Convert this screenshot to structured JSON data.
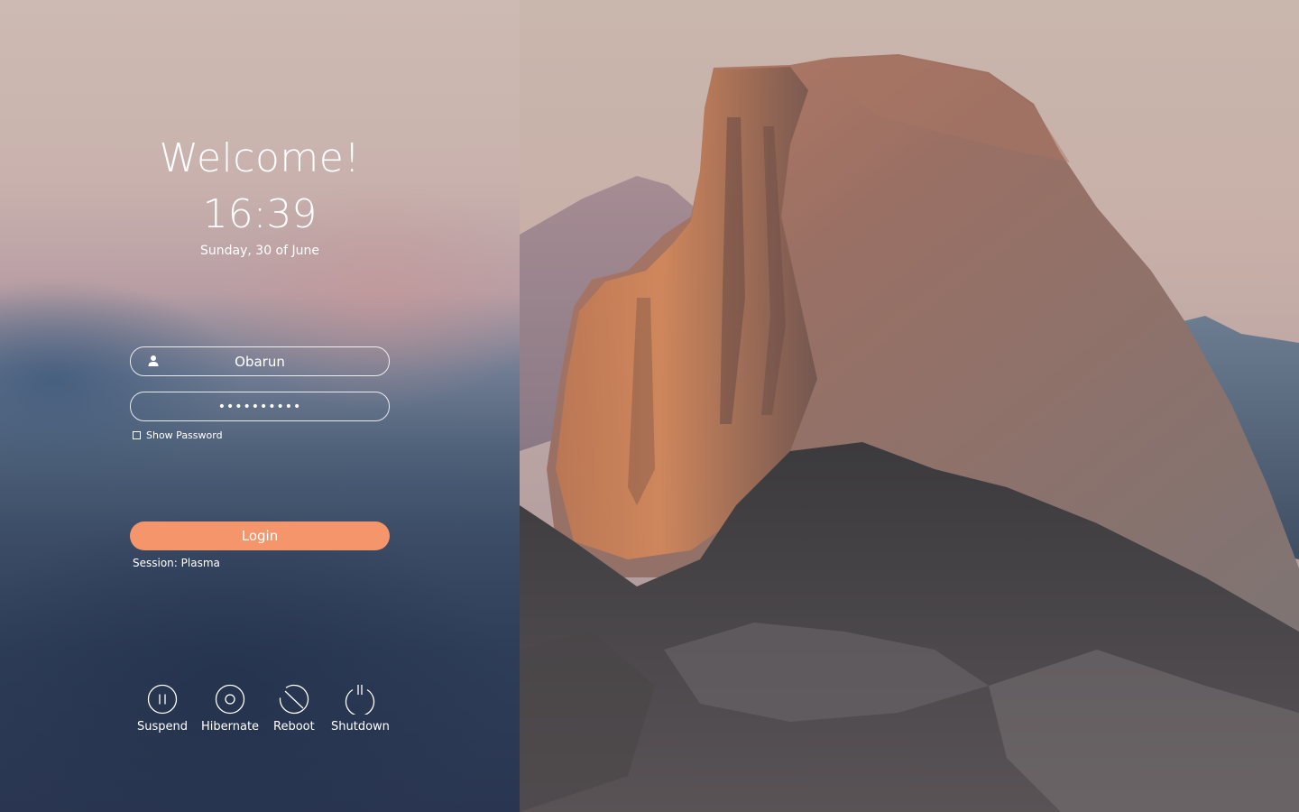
{
  "greeting": "Welcome!",
  "clock": {
    "time": "16:39",
    "date": "Sunday, 30 of June"
  },
  "login_form": {
    "username": "Obarun",
    "password_masked": "••••••••••",
    "user_icon": "user-icon",
    "show_password_label": "Show Password",
    "show_password_checked": false,
    "login_label": "Login",
    "session_text": "Session: Plasma"
  },
  "power_actions": [
    {
      "label": "Suspend",
      "icon": "pause-icon"
    },
    {
      "label": "Hibernate",
      "icon": "hibernate-icon"
    },
    {
      "label": "Reboot",
      "icon": "reboot-icon"
    },
    {
      "label": "Shutdown",
      "icon": "power-icon"
    }
  ],
  "colors": {
    "accent": "#f5956b",
    "text": "#ffffff"
  }
}
